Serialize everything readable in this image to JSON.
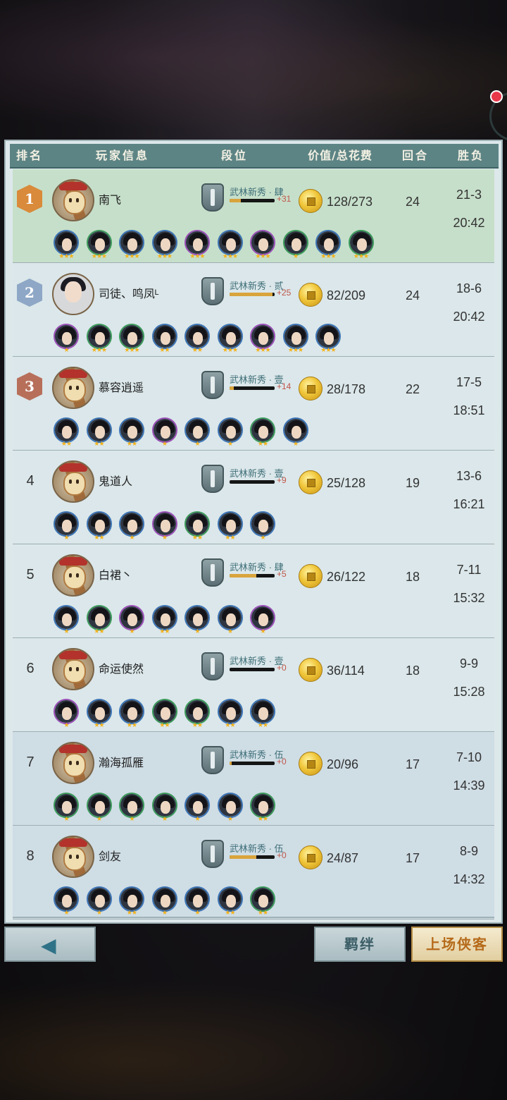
{
  "header": {
    "rank": "排名",
    "player_info": "玩家信息",
    "tier": "段位",
    "value_cost": "价值/总花费",
    "rounds": "回合",
    "win_loss": "胜负"
  },
  "rows": [
    {
      "rank": "1",
      "name": "南飞",
      "avatar": "doll",
      "tier": "武林新秀 · 肆",
      "tier_progress": 0.25,
      "tier_plus": "+31",
      "value": "128/273",
      "rounds": "24",
      "wl": "21-3",
      "time": "20:42",
      "heroes": [
        {
          "stars": "★★★",
          "border": "blue"
        },
        {
          "stars": "★★★",
          "border": "green"
        },
        {
          "stars": "★★★",
          "border": "blue"
        },
        {
          "stars": "★★★",
          "border": "blue"
        },
        {
          "stars": "★★★",
          "border": "purple"
        },
        {
          "stars": "★★★",
          "border": "blue"
        },
        {
          "stars": "★★★",
          "border": "purple"
        },
        {
          "stars": "★",
          "border": "green"
        },
        {
          "stars": "★★★",
          "border": "blue"
        },
        {
          "stars": "★★★",
          "border": "green"
        }
      ]
    },
    {
      "rank": "2",
      "name": "司徒、鸣凤ᴸ",
      "avatar": "person",
      "tier": "武林新秀 · 贰",
      "tier_progress": 0.95,
      "tier_plus": "+25",
      "value": "82/209",
      "rounds": "24",
      "wl": "18-6",
      "time": "20:42",
      "heroes": [
        {
          "stars": "★",
          "border": "purple"
        },
        {
          "stars": "★★★",
          "border": "green"
        },
        {
          "stars": "★★★",
          "border": "green"
        },
        {
          "stars": "★★",
          "border": "blue"
        },
        {
          "stars": "★★",
          "border": "blue"
        },
        {
          "stars": "★★★",
          "border": "blue"
        },
        {
          "stars": "★★★",
          "border": "purple"
        },
        {
          "stars": "★★★",
          "border": "blue"
        },
        {
          "stars": "★★★",
          "border": "blue"
        }
      ]
    },
    {
      "rank": "3",
      "name": "慕容逍遥",
      "avatar": "doll",
      "tier": "武林新秀 · 壹",
      "tier_progress": 0.1,
      "tier_plus": "+14",
      "value": "28/178",
      "rounds": "22",
      "wl": "17-5",
      "time": "18:51",
      "heroes": [
        {
          "stars": "★★",
          "border": "blue"
        },
        {
          "stars": "★★",
          "border": "blue"
        },
        {
          "stars": "★★",
          "border": "blue"
        },
        {
          "stars": "★",
          "border": "purple"
        },
        {
          "stars": "★",
          "border": "blue"
        },
        {
          "stars": "★",
          "border": "blue"
        },
        {
          "stars": "★★",
          "border": "green"
        },
        {
          "stars": "★",
          "border": "blue"
        }
      ]
    },
    {
      "rank": "4",
      "name": "鬼道人",
      "avatar": "doll",
      "tier": "武林新秀 · 壹",
      "tier_progress": 0.0,
      "tier_plus": "+9",
      "value": "25/128",
      "rounds": "19",
      "wl": "13-6",
      "time": "16:21",
      "heroes": [
        {
          "stars": "★",
          "border": "blue"
        },
        {
          "stars": "★★",
          "border": "blue"
        },
        {
          "stars": "★",
          "border": "blue"
        },
        {
          "stars": "★",
          "border": "purple"
        },
        {
          "stars": "★★",
          "border": "green"
        },
        {
          "stars": "★★",
          "border": "blue"
        },
        {
          "stars": "★",
          "border": "blue"
        }
      ]
    },
    {
      "rank": "5",
      "name": "白裙丶",
      "avatar": "doll",
      "tier": "武林新秀 · 肆",
      "tier_progress": 0.6,
      "tier_plus": "+5",
      "value": "26/122",
      "rounds": "18",
      "wl": "7-11",
      "time": "15:32",
      "heroes": [
        {
          "stars": "★",
          "border": "blue"
        },
        {
          "stars": "★★",
          "border": "green"
        },
        {
          "stars": "★",
          "border": "purple"
        },
        {
          "stars": "★★",
          "border": "blue"
        },
        {
          "stars": "★",
          "border": "blue"
        },
        {
          "stars": "★",
          "border": "blue"
        },
        {
          "stars": "★",
          "border": "purple"
        }
      ]
    },
    {
      "rank": "6",
      "name": "命运使然",
      "avatar": "doll",
      "tier": "武林新秀 · 壹",
      "tier_progress": 0.0,
      "tier_plus": "+0",
      "value": "36/114",
      "rounds": "18",
      "wl": "9-9",
      "time": "15:28",
      "heroes": [
        {
          "stars": "★",
          "border": "purple"
        },
        {
          "stars": "★★",
          "border": "blue"
        },
        {
          "stars": "★★",
          "border": "blue"
        },
        {
          "stars": "★★",
          "border": "green"
        },
        {
          "stars": "★★",
          "border": "green"
        },
        {
          "stars": "★★",
          "border": "blue"
        },
        {
          "stars": "★★",
          "border": "blue"
        }
      ]
    },
    {
      "rank": "7",
      "name": "瀚海孤雁",
      "avatar": "doll",
      "tier": "武林新秀 · 伍",
      "tier_progress": 0.05,
      "tier_plus": "+0",
      "value": "20/96",
      "rounds": "17",
      "wl": "7-10",
      "time": "14:39",
      "heroes": [
        {
          "stars": "★",
          "border": "green"
        },
        {
          "stars": "★",
          "border": "green"
        },
        {
          "stars": "★",
          "border": "green"
        },
        {
          "stars": "★",
          "border": "green"
        },
        {
          "stars": "★",
          "border": "blue"
        },
        {
          "stars": "★",
          "border": "blue"
        },
        {
          "stars": "★★",
          "border": "green"
        }
      ]
    },
    {
      "rank": "8",
      "name": "剑友",
      "avatar": "doll",
      "tier": "武林新秀 · 伍",
      "tier_progress": 0.6,
      "tier_plus": "+0",
      "value": "24/87",
      "rounds": "17",
      "wl": "8-9",
      "time": "14:32",
      "heroes": [
        {
          "stars": "★",
          "border": "blue"
        },
        {
          "stars": "★",
          "border": "blue"
        },
        {
          "stars": "★★",
          "border": "blue"
        },
        {
          "stars": "★",
          "border": "blue"
        },
        {
          "stars": "★",
          "border": "blue"
        },
        {
          "stars": "★★",
          "border": "blue"
        },
        {
          "stars": "★★",
          "border": "green"
        }
      ]
    }
  ],
  "buttons": {
    "back_icon": "back-arrow-icon",
    "bond": "羁绊",
    "heroes": "上场侠客"
  },
  "colors": {
    "header": "#5d8484",
    "first_row": "#c6dfca",
    "star": "#f2b21a",
    "gold_badge": "#d98a3a",
    "silver_badge": "#8ea7c6",
    "bronze_badge": "#b76f5a"
  }
}
